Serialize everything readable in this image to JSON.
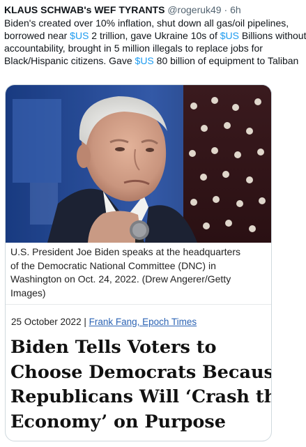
{
  "tweet": {
    "author_name": "KLAUS SCHWAB's WEF TYRANTS",
    "author_handle": "@rogeruk49",
    "separator": "·",
    "timestamp": "6h",
    "text_lines": [
      [
        {
          "t": "text",
          "v": "Biden's created over 10% inflation, shut down all gas/oil pipelines,"
        }
      ],
      [
        {
          "t": "text",
          "v": "borrowed near "
        },
        {
          "t": "cashtag",
          "v": "$US"
        },
        {
          "t": "text",
          "v": " 2 trillion, gave Ukraine 10s of "
        },
        {
          "t": "cashtag",
          "v": "$US"
        },
        {
          "t": "text",
          "v": " Billions without"
        }
      ],
      [
        {
          "t": "text",
          "v": "accountability, brought in 5 million illegals to replace jobs for"
        }
      ],
      [
        {
          "t": "text",
          "v": "Black/Hispanic citizens. Gave "
        },
        {
          "t": "cashtag",
          "v": "$US"
        },
        {
          "t": "text",
          "v": " 80 billion of equipment to Taliban"
        }
      ]
    ]
  },
  "article": {
    "caption_lines": [
      "U.S. President Joe Biden speaks at the headquarters",
      "of the Democratic National Committee (DNC) in",
      "Washington on Oct. 24, 2022. (Drew Angerer/Getty",
      "Images)"
    ],
    "date": "25 October 2022",
    "date_separator": " | ",
    "byline": "Frank Fang, Epoch Times",
    "headline_lines": [
      "Biden Tells Voters to",
      "Choose Democrats Because",
      "Republicans Will ‘Crash the",
      "Economy’ on Purpose"
    ]
  },
  "colors": {
    "link_blue": "#1d9bf0",
    "byline_blue": "#2b63b4",
    "muted_gray": "#536471",
    "card_border": "#cfd9de"
  }
}
